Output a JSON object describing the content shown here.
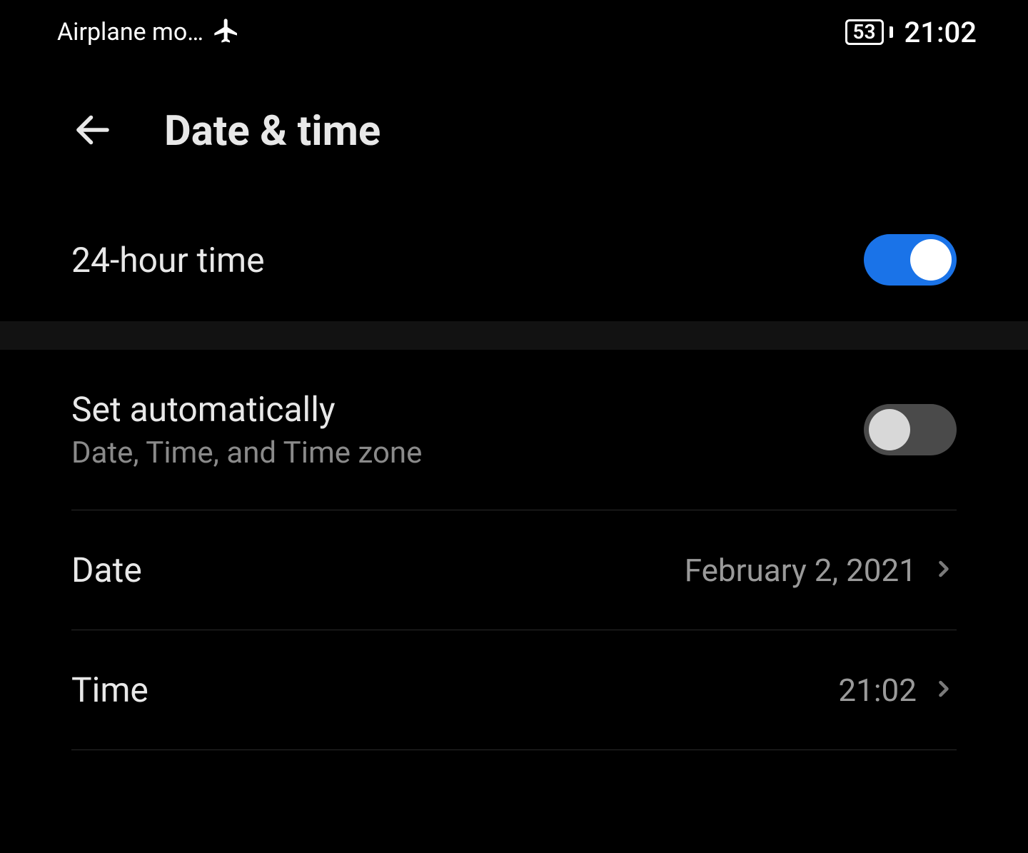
{
  "status_bar": {
    "mode_text": "Airplane mo…",
    "battery_level": "53",
    "clock": "21:02"
  },
  "header": {
    "title": "Date & time"
  },
  "settings": {
    "twenty_four_hour": {
      "label": "24-hour time",
      "enabled": true
    },
    "set_automatically": {
      "label": "Set automatically",
      "sublabel": "Date, Time, and Time zone",
      "enabled": false
    },
    "date": {
      "label": "Date",
      "value": "February 2, 2021"
    },
    "time": {
      "label": "Time",
      "value": "21:02"
    }
  }
}
